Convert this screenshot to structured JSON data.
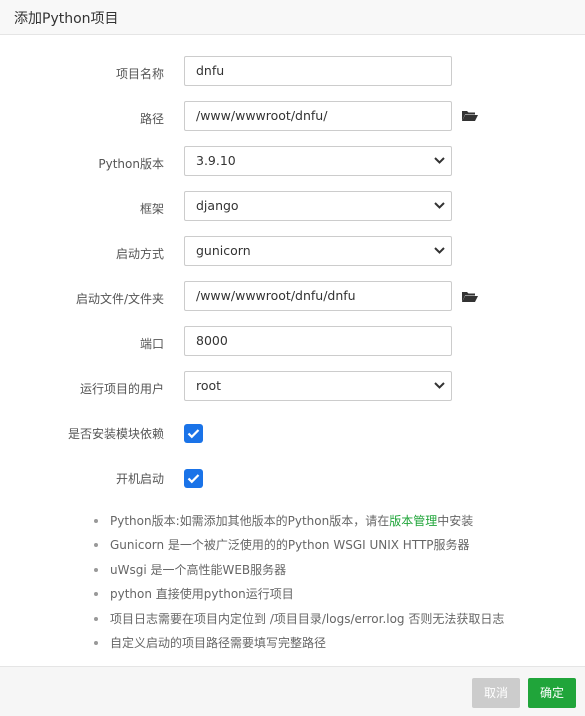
{
  "dialog": {
    "title": "添加Python项目"
  },
  "form": {
    "project_name": {
      "label": "项目名称",
      "value": "dnfu"
    },
    "path": {
      "label": "路径",
      "value": "/www/wwwroot/dnfu/"
    },
    "python_version": {
      "label": "Python版本",
      "value": "3.9.10"
    },
    "framework": {
      "label": "框架",
      "value": "django"
    },
    "start_method": {
      "label": "启动方式",
      "value": "gunicorn"
    },
    "startup_file": {
      "label": "启动文件/文件夹",
      "value": "/www/wwwroot/dnfu/dnfu"
    },
    "port": {
      "label": "端口",
      "value": "8000"
    },
    "run_user": {
      "label": "运行项目的用户",
      "value": "root"
    },
    "install_deps": {
      "label": "是否安装模块依赖",
      "checked": true
    },
    "autostart": {
      "label": "开机启动",
      "checked": true
    }
  },
  "notes": {
    "item1_prefix": "Python版本:如需添加其他版本的Python版本，请在",
    "item1_link": "版本管理",
    "item1_suffix": "中安装",
    "item2": "Gunicorn 是一个被广泛使用的的Python WSGI UNIX HTTP服务器",
    "item3": "uWsgi 是一个高性能WEB服务器",
    "item4": "python 直接使用python运行项目",
    "item5": "项目日志需要在项目内定位到 /项目目录/logs/error.log 否则无法获取日志",
    "item6": "自定义启动的项目路径需要填写完整路径"
  },
  "footer": {
    "cancel_label": "取消",
    "confirm_label": "确定"
  },
  "colors": {
    "accent": "#20a53a",
    "checkbox": "#1a73e8",
    "cancel_bg": "#cccccc"
  },
  "icons": {
    "folder": "folder-open-icon",
    "chevron": "chevron-down-icon",
    "check": "check-icon"
  }
}
